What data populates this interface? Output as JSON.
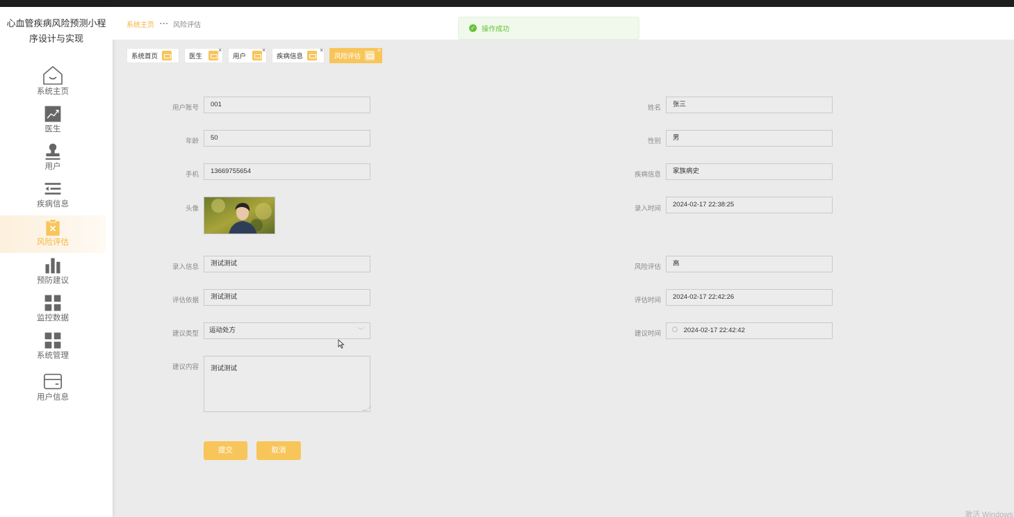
{
  "app": {
    "title": "心血管疾病风险预测小程序设计与实现"
  },
  "sidebar": {
    "items": [
      {
        "label": "系统主页",
        "icon": "home-icon"
      },
      {
        "label": "医生",
        "icon": "chart-trend-icon"
      },
      {
        "label": "用户",
        "icon": "user-stamp-icon"
      },
      {
        "label": "疾病信息",
        "icon": "list-indent-icon"
      },
      {
        "label": "风险评估",
        "icon": "clipboard-x-icon",
        "active": true
      },
      {
        "label": "预防建议",
        "icon": "bar-chart-icon"
      },
      {
        "label": "监控数据",
        "icon": "grid-icon"
      },
      {
        "label": "系统管理",
        "icon": "grid-icon"
      },
      {
        "label": "用户信息",
        "icon": "card-icon"
      }
    ]
  },
  "breadcrumb": {
    "home": "系统主页",
    "current": "风险评估"
  },
  "toast": {
    "text": "操作成功"
  },
  "tags": [
    {
      "label": "系统首页"
    },
    {
      "label": "医生"
    },
    {
      "label": "用户"
    },
    {
      "label": "疾病信息"
    },
    {
      "label": "风险评估"
    }
  ],
  "form": {
    "account": {
      "label": "用户账号",
      "value": "001"
    },
    "name": {
      "label": "姓名",
      "value": "张三"
    },
    "age": {
      "label": "年龄",
      "value": "50"
    },
    "gender": {
      "label": "性别",
      "value": "男"
    },
    "phone": {
      "label": "手机",
      "value": "13669755654"
    },
    "disease": {
      "label": "疾病信息",
      "value": "家族病史"
    },
    "avatar": {
      "label": "头像"
    },
    "entry_time": {
      "label": "录入时间",
      "value": "2024-02-17 22:38:25"
    },
    "entry_info": {
      "label": "录入信息",
      "value": "测试测试"
    },
    "risk": {
      "label": "风险评估",
      "value": "高"
    },
    "basis": {
      "label": "评估依据",
      "value": "测试测试"
    },
    "eval_time": {
      "label": "评估时间",
      "value": "2024-02-17 22:42:26"
    },
    "advice_type": {
      "label": "建议类型",
      "value": "运动处方"
    },
    "advice_time": {
      "label": "建议时间",
      "value": "2024-02-17 22:42:42"
    },
    "advice_content": {
      "label": "建议内容",
      "value": "测试测试"
    }
  },
  "buttons": {
    "submit": "提交",
    "cancel": "取消"
  },
  "watermark": "激活 Windows",
  "colors": {
    "accent": "#f8c55b",
    "success": "#67c23a",
    "background": "#ebebeb"
  }
}
